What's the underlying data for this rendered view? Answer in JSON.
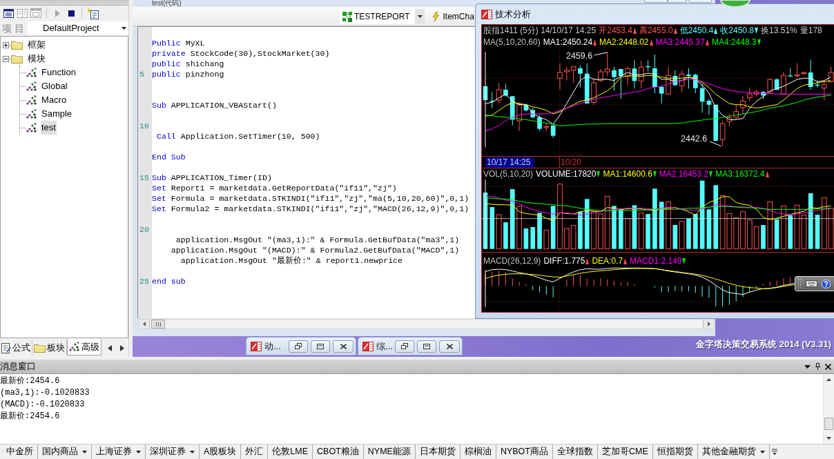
{
  "project_panel": {
    "toolbar": [
      {
        "disabled": false
      },
      {
        "disabled": true
      },
      {
        "disabled": true
      },
      {
        "disabled": true
      },
      {
        "disabled": false
      },
      {
        "disabled": false
      }
    ],
    "project_label": "项 目",
    "project_value": "DefaultProject",
    "tree": [
      {
        "label": "框架",
        "expanded": false,
        "selected": false
      },
      {
        "label": "模块",
        "expanded": true,
        "selected": false,
        "children": [
          {
            "label": "Function",
            "selected": false
          },
          {
            "label": "Global",
            "selected": false
          },
          {
            "label": "Macro",
            "selected": false
          },
          {
            "label": "Sample",
            "selected": false
          },
          {
            "label": "test",
            "selected": true
          }
        ]
      }
    ],
    "tabs": [
      {
        "label": "公式",
        "selected": false
      },
      {
        "label": "板块",
        "selected": false
      },
      {
        "label": "高级",
        "selected": true
      }
    ]
  },
  "code_window": {
    "title": "test(代码)",
    "report_selector": "TESTREPORT",
    "item_button": "ItemCha",
    "lines": [
      {
        "kind": "blank"
      },
      {
        "kind": "code",
        "segments": [
          {
            "kind": "keyword",
            "text": "Public"
          },
          {
            "kind": "plain",
            "text": " MyXL"
          }
        ]
      },
      {
        "kind": "code",
        "segments": [
          {
            "kind": "keyword",
            "text": "private"
          },
          {
            "kind": "plain",
            "text": " StockCode(30),StockMarket(30)"
          }
        ]
      },
      {
        "kind": "code",
        "segments": [
          {
            "kind": "keyword",
            "text": "public"
          },
          {
            "kind": "plain",
            "text": " shichang"
          }
        ]
      },
      {
        "kind": "code",
        "number": "5",
        "segments": [
          {
            "kind": "keyword",
            "text": "public"
          },
          {
            "kind": "plain",
            "text": " pinzhong"
          }
        ]
      },
      {
        "kind": "blank"
      },
      {
        "kind": "blank"
      },
      {
        "kind": "code",
        "segments": [
          {
            "kind": "keyword",
            "text": "Sub"
          },
          {
            "kind": "plain",
            "text": " APPLICATION_VBAStart()"
          }
        ]
      },
      {
        "kind": "blank"
      },
      {
        "kind": "code",
        "number": "10"
      },
      {
        "kind": "code",
        "segments": [
          {
            "kind": "keyword",
            "text": " Call"
          },
          {
            "kind": "plain",
            "text": " Application.SetTimer(10, 500)"
          }
        ]
      },
      {
        "kind": "blank"
      },
      {
        "kind": "code",
        "segments": [
          {
            "kind": "keyword",
            "text": "End Sub"
          }
        ]
      },
      {
        "kind": "blank"
      },
      {
        "kind": "code",
        "number": "15",
        "segments": [
          {
            "kind": "keyword",
            "text": "Sub"
          },
          {
            "kind": "plain",
            "text": " APPLICATION_Timer(ID)"
          }
        ]
      },
      {
        "kind": "code",
        "segments": [
          {
            "kind": "keyword",
            "text": "Set"
          },
          {
            "kind": "plain",
            "text": " Report1 = marketdata.GetReportData(\"if11\",\"zj\")"
          }
        ]
      },
      {
        "kind": "code",
        "segments": [
          {
            "kind": "keyword",
            "text": "Set"
          },
          {
            "kind": "plain",
            "text": " Formula = marketdata.STKINDI(\"if11\",\"zj\",\"ma(5,10,20,60)\",0,1)"
          }
        ]
      },
      {
        "kind": "code",
        "segments": [
          {
            "kind": "keyword",
            "text": "Set"
          },
          {
            "kind": "plain",
            "text": " Formula2 = marketdata.STKINDI(\"if11\",\"zj\",\"MACD(26,12,9)\",0,1)"
          }
        ]
      },
      {
        "kind": "blank"
      },
      {
        "kind": "code",
        "number": "20"
      },
      {
        "kind": "code",
        "segments": [
          {
            "kind": "plain",
            "text": "     application.MsgOut \"(ma3,1):\" & Formula.GetBufData(\"ma3\",1)"
          }
        ]
      },
      {
        "kind": "code",
        "segments": [
          {
            "kind": "plain",
            "text": "    application.MsgOut \"(MACD):\" & Formula2.GetBufData(\"MACD\",1)"
          }
        ]
      },
      {
        "kind": "code",
        "segments": [
          {
            "kind": "plain",
            "text": "      application.MsgOut \"最新价:\" & report1.newprice"
          }
        ]
      },
      {
        "kind": "blank"
      },
      {
        "kind": "code",
        "number": "25",
        "segments": [
          {
            "kind": "keyword",
            "text": "end sub"
          }
        ]
      }
    ]
  },
  "chart_window": {
    "title": "技术分析",
    "quote": {
      "kind": "quote",
      "items": [
        {
          "text": "股指1411 (5分) 14/10/17 14:25",
          "color": "#c8c8c8"
        },
        {
          "text": "开2453.4",
          "color": "#ff5454",
          "rising": true
        },
        {
          "text": "高2455.0",
          "color": "#ff5454",
          "rising": true
        },
        {
          "text": "低2450.4",
          "color": "#54fcfc",
          "rising": true
        },
        {
          "text": "收2450.8",
          "color": "#54fcfc",
          "rising": false
        },
        {
          "text": "换13.51%",
          "color": "#c8c8c8"
        },
        {
          "text": "量178",
          "color": "#c8c8c8"
        }
      ]
    },
    "ma_legend": {
      "kind": "indicator",
      "title": "MA(5,10,20,60)",
      "items": [
        {
          "text": "MA1:2450.24",
          "color": "#ffffff",
          "rising": true
        },
        {
          "text": "MA2:2448.02",
          "color": "#ffff00",
          "rising": true
        },
        {
          "text": "MA3:2445.37",
          "color": "#ff00ff",
          "rising": true
        },
        {
          "text": "MA4:2448.3",
          "color": "#00ff00",
          "rising": false
        }
      ]
    },
    "price_labels": [
      {
        "kind": "high",
        "text": "2459.6"
      },
      {
        "kind": "low",
        "text": "2442.6"
      }
    ],
    "cursor_time": "10/17 14:25",
    "date_marker": "10/20",
    "volume_legend": {
      "kind": "indicator",
      "title": "VOL(5,10,20)",
      "items": [
        {
          "text": "VOLUME:17820",
          "color": "#ffffff",
          "rising": false
        },
        {
          "text": "MA1:14600.6",
          "color": "#ffff00",
          "rising": false
        },
        {
          "text": "MA2:16453.2",
          "color": "#ff00ff",
          "rising": false
        },
        {
          "text": "MA3:16372.4",
          "color": "#00ff00",
          "rising": true
        }
      ]
    },
    "macd_legend": {
      "kind": "indicator",
      "title": "MACD(26,12,9)",
      "items": [
        {
          "text": "DIFF:1.775",
          "color": "#ffffff",
          "rising": true
        },
        {
          "text": "DEA:0.7",
          "color": "#ffff00",
          "rising": true
        },
        {
          "text": "MACD1:2.149",
          "color": "#ff00ff",
          "rising": false
        }
      ]
    }
  },
  "minimized_windows": [
    {
      "title": "动..."
    },
    {
      "title": "综..."
    }
  ],
  "brand_text": "金字塔决策交易系统 2014 (V3.31)",
  "message_window": {
    "title": "消息窗口",
    "lines": [
      "最新价:2454.6",
      "(ma3,1):-0.1020833",
      "(MACD):-0.1020833",
      "最新价:2454.6"
    ]
  },
  "market_tabs": [
    {
      "label": "中金所",
      "dropdown": false
    },
    {
      "label": "国内商品",
      "dropdown": true
    },
    {
      "label": "上海证券",
      "dropdown": true
    },
    {
      "label": "深圳证券",
      "dropdown": true
    },
    {
      "label": "A股板块",
      "dropdown": false
    },
    {
      "label": "外汇",
      "dropdown": false
    },
    {
      "label": "伦敦LME",
      "dropdown": false
    },
    {
      "label": "CBOT粮油",
      "dropdown": false
    },
    {
      "label": "NYME能源",
      "dropdown": false
    },
    {
      "label": "日本期货",
      "dropdown": false
    },
    {
      "label": "棕榈油",
      "dropdown": false
    },
    {
      "label": "NYBOT商品",
      "dropdown": false
    },
    {
      "label": "全球指数",
      "dropdown": false
    },
    {
      "label": "芝加哥CME",
      "dropdown": false
    },
    {
      "label": "恒指期货",
      "dropdown": false
    },
    {
      "label": "其他金融期货",
      "dropdown": true
    }
  ]
}
